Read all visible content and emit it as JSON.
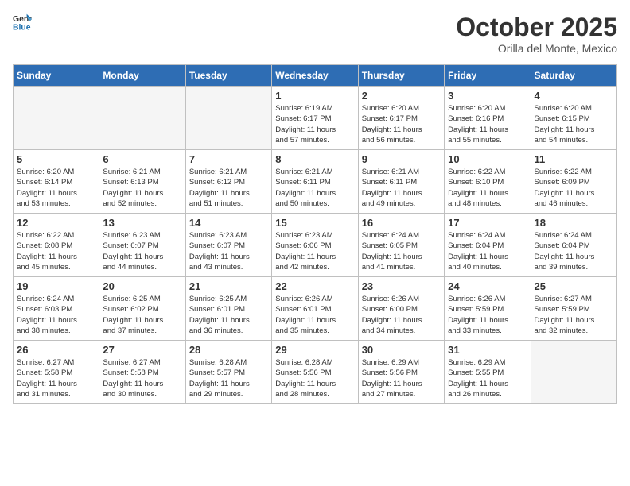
{
  "header": {
    "logo_general": "General",
    "logo_blue": "Blue",
    "month": "October 2025",
    "location": "Orilla del Monte, Mexico"
  },
  "days_of_week": [
    "Sunday",
    "Monday",
    "Tuesday",
    "Wednesday",
    "Thursday",
    "Friday",
    "Saturday"
  ],
  "weeks": [
    [
      {
        "day": "",
        "empty": true
      },
      {
        "day": "",
        "empty": true
      },
      {
        "day": "",
        "empty": true
      },
      {
        "day": "1",
        "info": "Sunrise: 6:19 AM\nSunset: 6:17 PM\nDaylight: 11 hours\nand 57 minutes."
      },
      {
        "day": "2",
        "info": "Sunrise: 6:20 AM\nSunset: 6:17 PM\nDaylight: 11 hours\nand 56 minutes."
      },
      {
        "day": "3",
        "info": "Sunrise: 6:20 AM\nSunset: 6:16 PM\nDaylight: 11 hours\nand 55 minutes."
      },
      {
        "day": "4",
        "info": "Sunrise: 6:20 AM\nSunset: 6:15 PM\nDaylight: 11 hours\nand 54 minutes."
      }
    ],
    [
      {
        "day": "5",
        "info": "Sunrise: 6:20 AM\nSunset: 6:14 PM\nDaylight: 11 hours\nand 53 minutes."
      },
      {
        "day": "6",
        "info": "Sunrise: 6:21 AM\nSunset: 6:13 PM\nDaylight: 11 hours\nand 52 minutes."
      },
      {
        "day": "7",
        "info": "Sunrise: 6:21 AM\nSunset: 6:12 PM\nDaylight: 11 hours\nand 51 minutes."
      },
      {
        "day": "8",
        "info": "Sunrise: 6:21 AM\nSunset: 6:11 PM\nDaylight: 11 hours\nand 50 minutes."
      },
      {
        "day": "9",
        "info": "Sunrise: 6:21 AM\nSunset: 6:11 PM\nDaylight: 11 hours\nand 49 minutes."
      },
      {
        "day": "10",
        "info": "Sunrise: 6:22 AM\nSunset: 6:10 PM\nDaylight: 11 hours\nand 48 minutes."
      },
      {
        "day": "11",
        "info": "Sunrise: 6:22 AM\nSunset: 6:09 PM\nDaylight: 11 hours\nand 46 minutes."
      }
    ],
    [
      {
        "day": "12",
        "info": "Sunrise: 6:22 AM\nSunset: 6:08 PM\nDaylight: 11 hours\nand 45 minutes."
      },
      {
        "day": "13",
        "info": "Sunrise: 6:23 AM\nSunset: 6:07 PM\nDaylight: 11 hours\nand 44 minutes."
      },
      {
        "day": "14",
        "info": "Sunrise: 6:23 AM\nSunset: 6:07 PM\nDaylight: 11 hours\nand 43 minutes."
      },
      {
        "day": "15",
        "info": "Sunrise: 6:23 AM\nSunset: 6:06 PM\nDaylight: 11 hours\nand 42 minutes."
      },
      {
        "day": "16",
        "info": "Sunrise: 6:24 AM\nSunset: 6:05 PM\nDaylight: 11 hours\nand 41 minutes."
      },
      {
        "day": "17",
        "info": "Sunrise: 6:24 AM\nSunset: 6:04 PM\nDaylight: 11 hours\nand 40 minutes."
      },
      {
        "day": "18",
        "info": "Sunrise: 6:24 AM\nSunset: 6:04 PM\nDaylight: 11 hours\nand 39 minutes."
      }
    ],
    [
      {
        "day": "19",
        "info": "Sunrise: 6:24 AM\nSunset: 6:03 PM\nDaylight: 11 hours\nand 38 minutes."
      },
      {
        "day": "20",
        "info": "Sunrise: 6:25 AM\nSunset: 6:02 PM\nDaylight: 11 hours\nand 37 minutes."
      },
      {
        "day": "21",
        "info": "Sunrise: 6:25 AM\nSunset: 6:01 PM\nDaylight: 11 hours\nand 36 minutes."
      },
      {
        "day": "22",
        "info": "Sunrise: 6:26 AM\nSunset: 6:01 PM\nDaylight: 11 hours\nand 35 minutes."
      },
      {
        "day": "23",
        "info": "Sunrise: 6:26 AM\nSunset: 6:00 PM\nDaylight: 11 hours\nand 34 minutes."
      },
      {
        "day": "24",
        "info": "Sunrise: 6:26 AM\nSunset: 5:59 PM\nDaylight: 11 hours\nand 33 minutes."
      },
      {
        "day": "25",
        "info": "Sunrise: 6:27 AM\nSunset: 5:59 PM\nDaylight: 11 hours\nand 32 minutes."
      }
    ],
    [
      {
        "day": "26",
        "info": "Sunrise: 6:27 AM\nSunset: 5:58 PM\nDaylight: 11 hours\nand 31 minutes."
      },
      {
        "day": "27",
        "info": "Sunrise: 6:27 AM\nSunset: 5:58 PM\nDaylight: 11 hours\nand 30 minutes."
      },
      {
        "day": "28",
        "info": "Sunrise: 6:28 AM\nSunset: 5:57 PM\nDaylight: 11 hours\nand 29 minutes."
      },
      {
        "day": "29",
        "info": "Sunrise: 6:28 AM\nSunset: 5:56 PM\nDaylight: 11 hours\nand 28 minutes."
      },
      {
        "day": "30",
        "info": "Sunrise: 6:29 AM\nSunset: 5:56 PM\nDaylight: 11 hours\nand 27 minutes."
      },
      {
        "day": "31",
        "info": "Sunrise: 6:29 AM\nSunset: 5:55 PM\nDaylight: 11 hours\nand 26 minutes."
      },
      {
        "day": "",
        "empty": true
      }
    ]
  ]
}
